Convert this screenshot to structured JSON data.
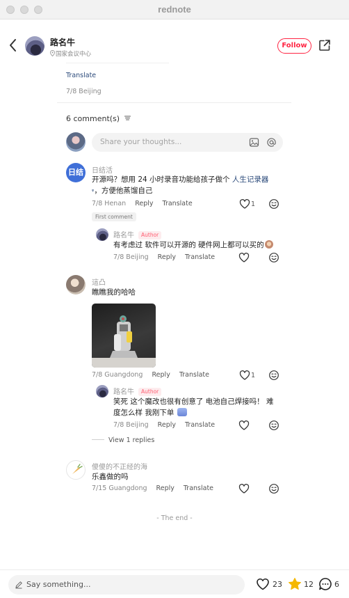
{
  "app": {
    "title": "rednote"
  },
  "author": {
    "name": "路名牛",
    "location": "国家会议中心",
    "follow_label": "Follow"
  },
  "note": {
    "translate_label": "Translate",
    "date_location": "7/8 Beijing"
  },
  "comments_header": {
    "count_label": "6 comment(s)"
  },
  "comment_input": {
    "placeholder": "Share your thoughts..."
  },
  "comments": [
    {
      "user": "日结活",
      "avatar_text": "日结",
      "text_before_link": "开源吗？想用 24 小时录音功能给孩子做个 ",
      "link_text": "人生记录器",
      "text_after_link": "，方便他蒸馏自己",
      "search_glyph": "ᵠ",
      "meta": "7/8 Henan",
      "reply_label": "Reply",
      "translate_label": "Translate",
      "likes": "1",
      "tag": "First comment",
      "replies": [
        {
          "user": "路名牛",
          "author_tag": "Author",
          "text": "有考虑过 软件可以开源的 硬件网上都可以买的",
          "meta": "7/8 Beijing",
          "reply_label": "Reply",
          "translate_label": "Translate"
        }
      ]
    },
    {
      "user": "這凸",
      "text": "瞧瞧我的哈哈",
      "meta": "7/8 Guangdong",
      "reply_label": "Reply",
      "translate_label": "Translate",
      "likes": "1",
      "replies": [
        {
          "user": "路名牛",
          "author_tag": "Author",
          "text_line1": "笑死 这个魔改也很有创意了 电池自己焊接吗！ 难",
          "text_line2": "度怎么样 我刚下单",
          "meta": "7/8 Beijing",
          "reply_label": "Reply",
          "translate_label": "Translate"
        }
      ],
      "view_replies_label": "View 1 replies"
    },
    {
      "user": "傻傻的不正经的海",
      "text": "乐鑫做的吗",
      "meta": "7/15 Guangdong",
      "reply_label": "Reply",
      "translate_label": "Translate"
    }
  ],
  "end_label": "- The end -",
  "bottom_bar": {
    "say_placeholder": "Say something...",
    "likes": "23",
    "stars": "12",
    "comments": "6"
  },
  "colors": {
    "accent": "#ff2442",
    "link": "#2b4a7a",
    "star": "#f5b800",
    "blue_avatar": "#3f6fd8"
  }
}
